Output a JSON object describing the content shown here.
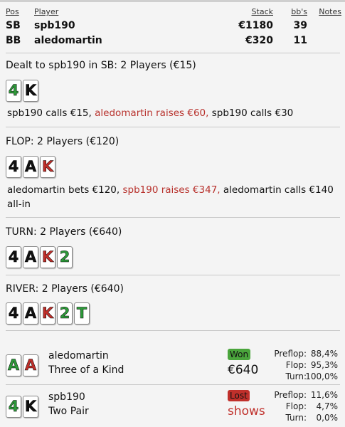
{
  "table": {
    "headers": {
      "pos": "Pos",
      "player": "Player",
      "stack": "Stack",
      "bbs": "bb's",
      "notes": "Notes"
    },
    "rows": [
      {
        "pos": "SB",
        "player": "spb190",
        "stack": "€1180",
        "bbs": "39"
      },
      {
        "pos": "BB",
        "player": "aledomartin",
        "stack": "€320",
        "bbs": "11"
      }
    ]
  },
  "preflop": {
    "title": "Dealt to spb190 in SB: 2 Players (€15)",
    "cards": [
      "4",
      "K"
    ],
    "action_1": "spb190 calls €15, ",
    "action_2": "aledomartin raises €60, ",
    "action_3": "spb190 calls €30"
  },
  "flop": {
    "title": "FLOP: 2 Players (€120)",
    "cards": [
      "4",
      "A",
      "K"
    ],
    "action_1": "aledomartin bets €120, ",
    "action_2": "spb190 raises €347, ",
    "action_3": "aledomartin calls €140 all-in"
  },
  "turn": {
    "title": "TURN: 2 Players (€640)",
    "cards": [
      "4",
      "A",
      "K",
      "2"
    ]
  },
  "river": {
    "title": "RIVER: 2 Players (€640)",
    "cards": [
      "4",
      "A",
      "K",
      "2",
      "T"
    ]
  },
  "results": [
    {
      "cards": [
        "A",
        "A"
      ],
      "name": "aledomartin",
      "hand": "Three of a Kind",
      "status": "Won",
      "amount": "€640",
      "equity": {
        "preflop_label": "Preflop:",
        "preflop": "88,4%",
        "flop_label": "Flop:",
        "flop": "95,3%",
        "turn_label": "Turn:",
        "turn": "100,0%"
      }
    },
    {
      "cards": [
        "4",
        "K"
      ],
      "name": "spb190",
      "hand": "Two Pair",
      "status": "Lost",
      "amount": "shows",
      "equity": {
        "preflop_label": "Preflop:",
        "preflop": "11,6%",
        "flop_label": "Flop:",
        "flop": "4,7%",
        "turn_label": "Turn:",
        "turn": "0,0%"
      }
    }
  ],
  "colors": {
    "spade": "#111111",
    "heart": "#c0302b",
    "club": "#2e9a3a",
    "won": "#4aa53c",
    "lost": "#c0302b"
  }
}
